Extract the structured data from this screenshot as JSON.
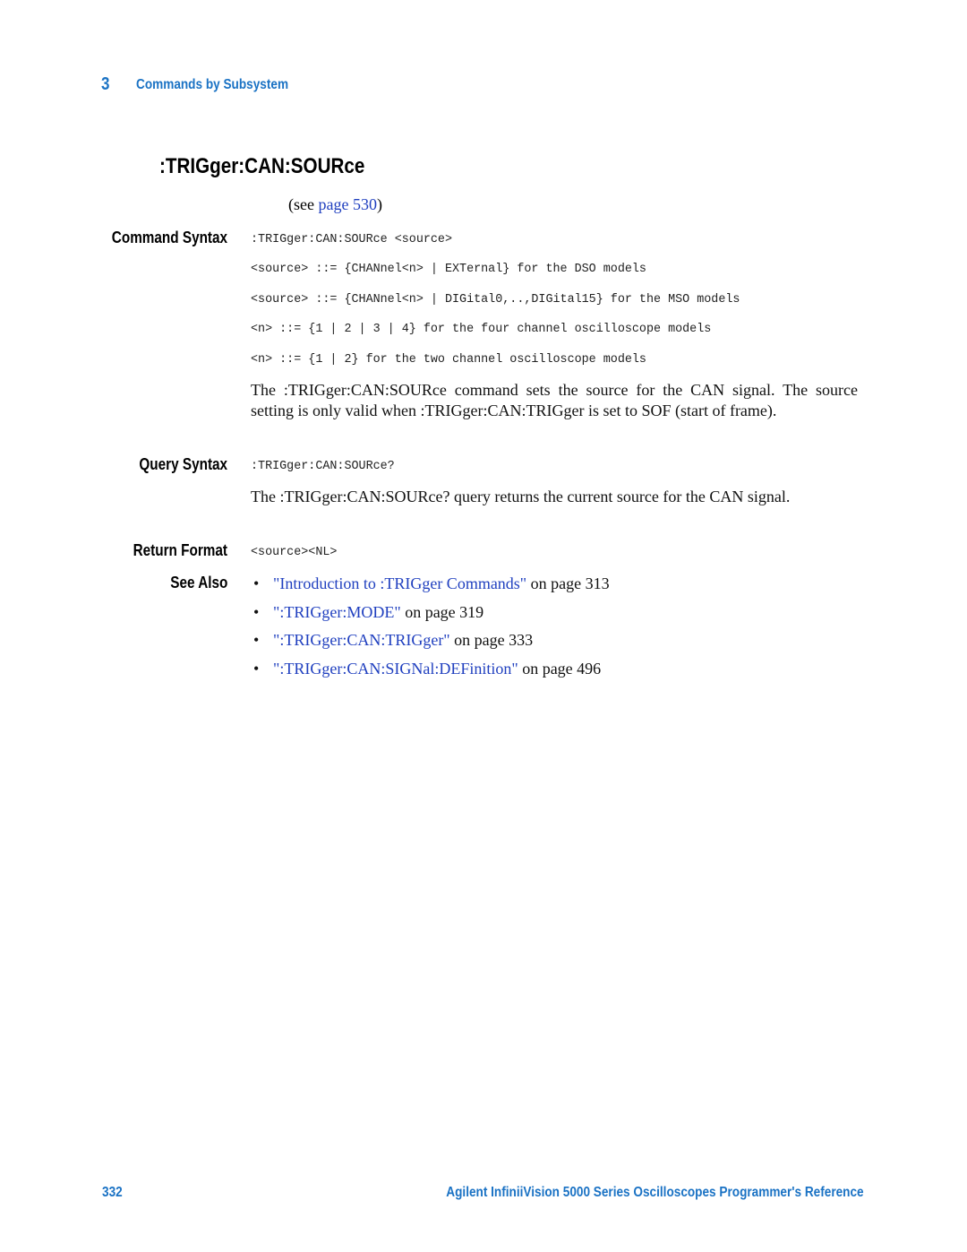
{
  "header": {
    "chapter_number": "3",
    "chapter_title": "Commands by Subsystem"
  },
  "command": {
    "title": ":TRIGger:CAN:SOURce",
    "see_prefix": "(see ",
    "see_link": "page 530",
    "see_suffix": ")"
  },
  "command_syntax": {
    "label": "Command Syntax",
    "lines": [
      ":TRIGger:CAN:SOURce <source>",
      "<source> ::= {CHANnel<n> | EXTernal} for the DSO models",
      "<source> ::= {CHANnel<n> | DIGital0,..,DIGital15} for the MSO models",
      "<n> ::= {1 | 2 | 3 | 4} for the four channel oscilloscope models",
      "<n> ::= {1 | 2} for the two channel oscilloscope models"
    ],
    "description": "The :TRIGger:CAN:SOURce command sets the source for the CAN signal. The source setting is only valid when :TRIGger:CAN:TRIGger is set to SOF (start of frame)."
  },
  "query_syntax": {
    "label": "Query Syntax",
    "line": ":TRIGger:CAN:SOURce?",
    "description": "The :TRIGger:CAN:SOURce? query returns the current source for the CAN signal."
  },
  "return_format": {
    "label": "Return Format",
    "line": "<source><NL>"
  },
  "see_also": {
    "label": "See Also",
    "items": [
      {
        "link": "\"Introduction to :TRIGger Commands\"",
        "suffix": " on page 313"
      },
      {
        "link": "\":TRIGger:MODE\"",
        "suffix": " on page 319"
      },
      {
        "link": "\":TRIGger:CAN:TRIGger\"",
        "suffix": " on page 333"
      },
      {
        "link": "\":TRIGger:CAN:SIGNal:DEFinition\"",
        "suffix": " on page 496"
      }
    ]
  },
  "footer": {
    "page_number": "332",
    "book_title": "Agilent InfiniiVision 5000 Series Oscilloscopes Programmer's Reference"
  }
}
